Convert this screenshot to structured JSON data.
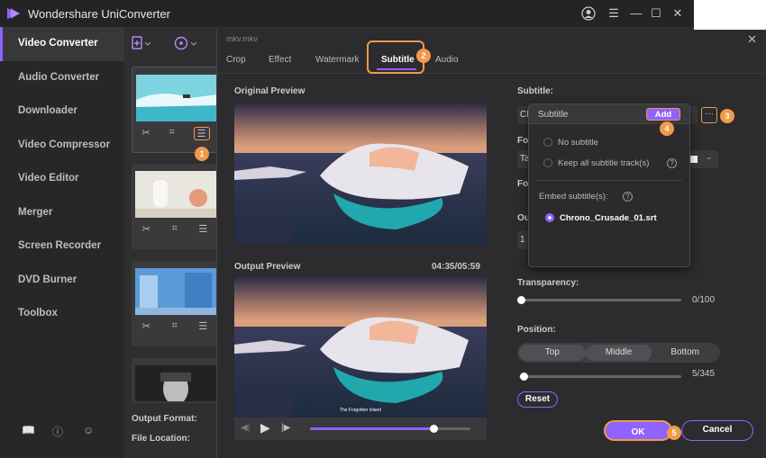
{
  "app": {
    "title": "Wondershare UniConverter"
  },
  "sidebar": {
    "items": [
      {
        "label": "Video Converter"
      },
      {
        "label": "Audio Converter"
      },
      {
        "label": "Downloader"
      },
      {
        "label": "Video Compressor"
      },
      {
        "label": "Video Editor"
      },
      {
        "label": "Merger"
      },
      {
        "label": "Screen Recorder"
      },
      {
        "label": "DVD Burner"
      },
      {
        "label": "Toolbox"
      }
    ]
  },
  "footer": {
    "output_format": "Output Format:",
    "file_location": "File Location:"
  },
  "dialog": {
    "filename": "mkv.mkv",
    "tabs": [
      {
        "label": "Crop"
      },
      {
        "label": "Effect"
      },
      {
        "label": "Watermark"
      },
      {
        "label": "Subtitle"
      },
      {
        "label": "Audio"
      }
    ],
    "original_preview": "Original Preview",
    "output_preview": "Output Preview",
    "time": "04:35/05:59",
    "caption": "The Forgotten Island",
    "progress": 0.77,
    "subtitle_label": "Subtitle:",
    "subtitle_value": "Ch",
    "font_label": "Fo",
    "font_value": "Ta",
    "font2_label": "Fo",
    "outline_label": "Ou",
    "outline_value": "1",
    "transparency_label": "Transparency:",
    "transparency_value": "0/100",
    "transparency_level": 0,
    "position_label": "Position:",
    "position_options": [
      {
        "label": "Top"
      },
      {
        "label": "Middle"
      },
      {
        "label": "Bottom"
      }
    ],
    "position_value": "5/345",
    "position_level": 0.014,
    "reset": "Reset",
    "ok": "OK",
    "cancel": "Cancel",
    "more": "···"
  },
  "popup": {
    "title": "Subtitle",
    "add": "Add",
    "no_subtitle": "No subtitle",
    "keep_all": "Keep all subtitle track(s)",
    "embed_label": "Embed subtitle(s):",
    "embed_file": "Chrono_Crusade_01.srt",
    "help": "?"
  },
  "badges": [
    "1",
    "2",
    "3",
    "4",
    "5"
  ],
  "colors": {
    "accent": "#8e63ff",
    "highlight": "#f2994a"
  }
}
